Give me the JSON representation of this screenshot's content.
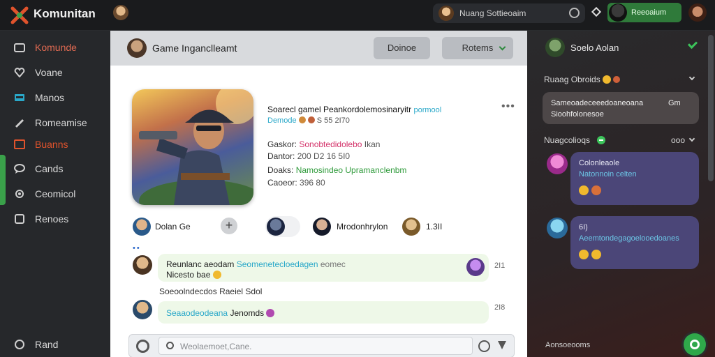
{
  "app": {
    "brand": "Komunitan",
    "colors": {
      "accent": "#2f7a3a",
      "highlight": "#e06a52",
      "link": "#2aa8c9"
    }
  },
  "topbar": {
    "search_text": "Nuang Sottieoaim",
    "user_name": "Reeoaium",
    "icons": [
      "logo-icon",
      "avatar",
      "refresh-icon",
      "diamond-icon",
      "avatar"
    ]
  },
  "sidebar": {
    "items": [
      {
        "label": "Komunde",
        "icon": "folder-icon"
      },
      {
        "label": "Voane",
        "icon": "heart-icon"
      },
      {
        "label": "Manos",
        "icon": "card-icon"
      },
      {
        "label": "Romeamise",
        "icon": "pencil-icon"
      },
      {
        "label": "Buanns",
        "icon": "box-icon"
      },
      {
        "label": "Cands",
        "icon": "chat-icon"
      },
      {
        "label": "Ceomicol",
        "icon": "gear-icon"
      },
      {
        "label": "Renoes",
        "icon": "square-icon"
      }
    ],
    "footer": "Rand"
  },
  "center": {
    "header": {
      "title": "Game Inganclleamt",
      "btn1": "Doinoe",
      "btn2": "Rotems"
    },
    "card": {
      "title": "Soarecl gamel Peankordolemosinaryitr",
      "title_accent": "pormool",
      "subtitle_accent": "Demode",
      "subtitle": "S 55 2I70",
      "meta1_label": "Gaskor",
      "meta1_value": "Sonobtedidolebo",
      "meta1_extra": "Ikan",
      "meta2_label": "Dantor",
      "meta2_value": "200 D2 16 5I0",
      "meta3_label": "Doaks",
      "meta3_value": "Namosindeo Upramanclenbm",
      "meta4_label": "Caoeor",
      "meta4_value": "396 80"
    },
    "players": {
      "p1": "Dolan Ge",
      "p3": "Mrodonhrylon",
      "p4": "1.3II"
    },
    "messages": {
      "m1_text": "Reunlanc aeodam",
      "m1_accent": "Seomenetecloedagen",
      "m1_grey": "eomec",
      "m1_line2": "Nicesto bae",
      "m1_time": "2I1",
      "label": "Soeoolndecdos Raeiel Sdol",
      "m2_accent": "Seaaodeodeana",
      "m2_text": "Jenomds",
      "m2_time": "2I8"
    },
    "compose": {
      "placeholder": "Weolaemoet,Cane."
    }
  },
  "right": {
    "header": "Soelo Aolan",
    "section1": "Ruaag Obroids",
    "bubble_line1": "Sameoadeceeedoaneoana",
    "bubble_line2": "Sioohfolonesoe",
    "bubble_side": "Gm",
    "section2": "Nuagcolioqs",
    "section2_right": "ooo",
    "card1_line1": "Colonleaole",
    "card1_line2": "Natonnoin celten",
    "card2_line1": "6I)",
    "card2_line2": "Aeemtondegagoelooedoanes",
    "footer": "Aonsoeooms"
  }
}
